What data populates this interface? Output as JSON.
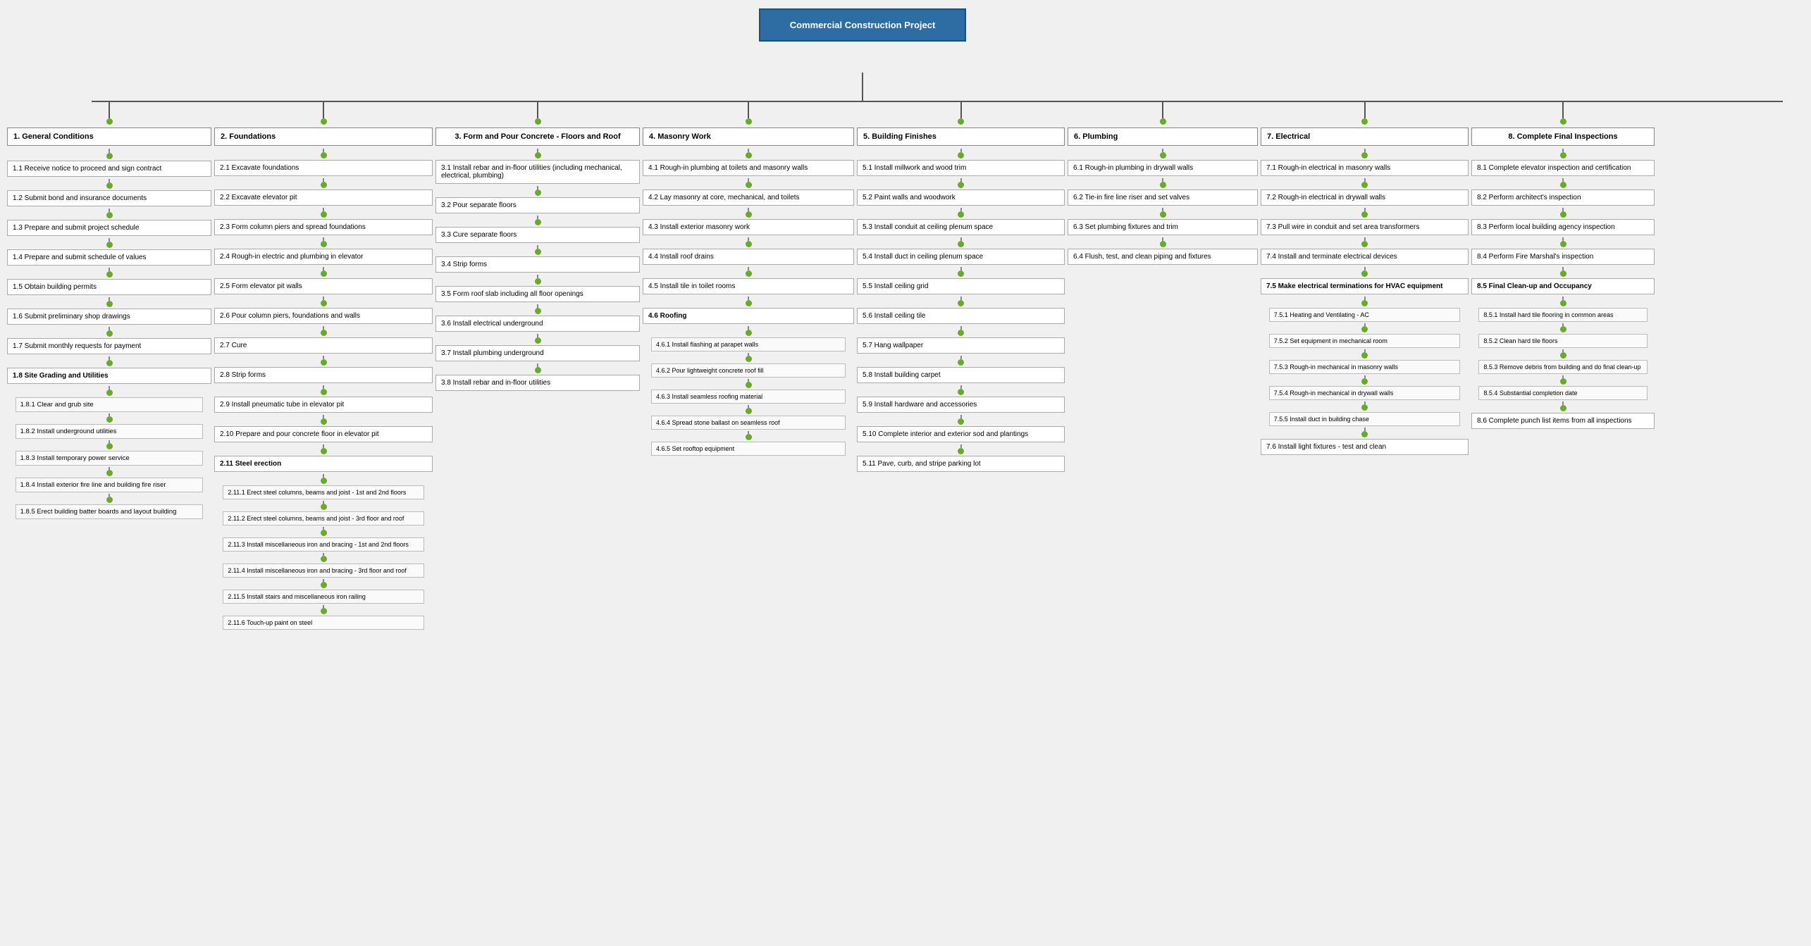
{
  "root": {
    "title": "Commercial Construction Project"
  },
  "columns": [
    {
      "id": "col1",
      "header": "1.  General Conditions",
      "tasks": [
        {
          "id": "1.1",
          "label": "1.1  Receive notice to proceed and sign contract"
        },
        {
          "id": "1.2",
          "label": "1.2  Submit bond and insurance documents"
        },
        {
          "id": "1.3",
          "label": "1.3  Prepare and submit project schedule"
        },
        {
          "id": "1.4",
          "label": "1.4  Prepare and submit schedule of values"
        },
        {
          "id": "1.5",
          "label": "1.5  Obtain building permits"
        },
        {
          "id": "1.6",
          "label": "1.6  Submit preliminary shop drawings"
        },
        {
          "id": "1.7",
          "label": "1.7  Submit monthly requests for payment"
        },
        {
          "id": "1.8",
          "label": "1.8  Site Grading and Utilities",
          "subtasks": [
            {
              "id": "1.8.1",
              "label": "1.8.1  Clear and grub site"
            },
            {
              "id": "1.8.2",
              "label": "1.8.2  Install underground utilities"
            },
            {
              "id": "1.8.3",
              "label": "1.8.3  Install temporary power service"
            },
            {
              "id": "1.8.4",
              "label": "1.8.4  Install exterior fire line and building fire riser"
            },
            {
              "id": "1.8.5",
              "label": "1.8.5  Erect building batter boards and layout building"
            }
          ]
        }
      ]
    },
    {
      "id": "col2",
      "header": "2.  Foundations",
      "tasks": [
        {
          "id": "2.1",
          "label": "2.1  Excavate foundations"
        },
        {
          "id": "2.2",
          "label": "2.2  Excavate elevator pit"
        },
        {
          "id": "2.3",
          "label": "2.3  Form column piers and spread foundations"
        },
        {
          "id": "2.4",
          "label": "2.4  Rough-in electric and plumbing in elevator"
        },
        {
          "id": "2.5",
          "label": "2.5  Form elevator pit walls"
        },
        {
          "id": "2.6",
          "label": "2.6  Pour column piers, foundations and walls"
        },
        {
          "id": "2.7",
          "label": "2.7  Cure"
        },
        {
          "id": "2.8",
          "label": "2.8  Strip forms"
        },
        {
          "id": "2.9",
          "label": "2.9  Install pneumatic tube in elevator pit"
        },
        {
          "id": "2.10",
          "label": "2.10  Prepare and pour concrete floor in elevator pit"
        },
        {
          "id": "2.11",
          "label": "2.11  Steel erection",
          "subtasks": [
            {
              "id": "2.11.1",
              "label": "2.11.1  Erect steel columns, beams and joist - 1st and 2nd floors"
            },
            {
              "id": "2.11.2",
              "label": "2.11.2  Erect steel columns, beams and joist - 3rd floor and roof"
            },
            {
              "id": "2.11.3",
              "label": "2.11.3  Install miscellaneous iron and bracing - 1st and 2nd floors"
            },
            {
              "id": "2.11.4",
              "label": "2.11.4  Install miscellaneous iron and bracing - 3rd floor and roof"
            },
            {
              "id": "2.11.5",
              "label": "2.11.5  Install stairs and miscellaneous iron railing"
            },
            {
              "id": "2.11.6",
              "label": "2.11.6  Touch-up paint on steel"
            }
          ]
        }
      ]
    },
    {
      "id": "col3",
      "header": "3.  Form and Pour Concrete - Floors and Roof",
      "tasks": [
        {
          "id": "3.1",
          "label": "3.1  Install rebar and in-floor utilities (including mechanical, electrical, plumbing)"
        },
        {
          "id": "3.2",
          "label": "3.2  Pour separate floors"
        },
        {
          "id": "3.3",
          "label": "3.3  Cure separate floors"
        },
        {
          "id": "3.4",
          "label": "3.4  Strip forms"
        },
        {
          "id": "3.5",
          "label": "3.5  Form roof slab including all floor openings"
        },
        {
          "id": "3.6",
          "label": "3.6  Install electrical underground"
        },
        {
          "id": "3.7",
          "label": "3.7  Install plumbing underground"
        },
        {
          "id": "3.8",
          "label": "3.8  Install rebar and in-floor utilities"
        }
      ]
    },
    {
      "id": "col4",
      "header": "4.  Masonry Work",
      "tasks": [
        {
          "id": "4.1",
          "label": "4.1  Rough-in plumbing at toilets and masonry walls"
        },
        {
          "id": "4.2",
          "label": "4.2  Lay masonry at core, mechanical, and toilets"
        },
        {
          "id": "4.3",
          "label": "4.3  Install exterior masonry work"
        },
        {
          "id": "4.4",
          "label": "4.4  Install roof drains"
        },
        {
          "id": "4.5",
          "label": "4.5  Install tile in toilet rooms"
        },
        {
          "id": "4.6",
          "label": "4.6  Roofing",
          "subtasks": [
            {
              "id": "4.6.1",
              "label": "4.6.1  Install flashing at parapet walls"
            },
            {
              "id": "4.6.2",
              "label": "4.6.2  Pour lightweight concrete roof fill"
            },
            {
              "id": "4.6.3",
              "label": "4.6.3  Install seamless roofing material"
            },
            {
              "id": "4.6.4",
              "label": "4.6.4  Spread stone ballast on seamless roof"
            },
            {
              "id": "4.6.5",
              "label": "4.6.5  Set rooftop equipment"
            }
          ]
        }
      ]
    },
    {
      "id": "col5",
      "header": "5.  Building Finishes",
      "tasks": [
        {
          "id": "5.1",
          "label": "5.1  Install millwork and wood trim"
        },
        {
          "id": "5.2",
          "label": "5.2  Paint walls and woodwork"
        },
        {
          "id": "5.3",
          "label": "5.3  Install conduit at ceiling plenum space"
        },
        {
          "id": "5.4",
          "label": "5.4  Install duct in ceiling plenum space"
        },
        {
          "id": "5.5",
          "label": "5.5  Install ceiling grid"
        },
        {
          "id": "5.6",
          "label": "5.6  Install ceiling tile"
        },
        {
          "id": "5.7",
          "label": "5.7  Hang wallpaper"
        },
        {
          "id": "5.8",
          "label": "5.8  Install building carpet"
        },
        {
          "id": "5.9",
          "label": "5.9  Install hardware and accessories"
        },
        {
          "id": "5.10",
          "label": "5.10  Complete interior and exterior sod and plantings"
        },
        {
          "id": "5.11",
          "label": "5.11  Pave, curb, and stripe parking lot"
        }
      ]
    },
    {
      "id": "col6",
      "header": "6.  Plumbing",
      "tasks": [
        {
          "id": "6.1",
          "label": "6.1  Rough-in plumbing in drywall walls"
        },
        {
          "id": "6.2",
          "label": "6.2  Tie-in fire line riser and set valves"
        },
        {
          "id": "6.3",
          "label": "6.3  Set plumbing fixtures and trim"
        },
        {
          "id": "6.4",
          "label": "6.4  Flush, test, and clean piping and fixtures"
        }
      ]
    },
    {
      "id": "col7",
      "header": "7.  Electrical",
      "tasks": [
        {
          "id": "7.1",
          "label": "7.1  Rough-in electrical in masonry walls"
        },
        {
          "id": "7.2",
          "label": "7.2  Rough-in electrical in drywall walls"
        },
        {
          "id": "7.3",
          "label": "7.3  Pull wire in conduit and set area transformers"
        },
        {
          "id": "7.4",
          "label": "7.4  Install and terminate electrical devices"
        },
        {
          "id": "7.5",
          "label": "7.5  Make electrical terminations for HVAC equipment",
          "subtasks": [
            {
              "id": "7.5.1",
              "label": "7.5.1  Heating and Ventilating - AC"
            },
            {
              "id": "7.5.2",
              "label": "7.5.2  Set equipment in mechanical room"
            },
            {
              "id": "7.5.3",
              "label": "7.5.3  Rough-in mechanical in masonry walls"
            },
            {
              "id": "7.5.4",
              "label": "7.5.4  Rough-in mechanical in drywall walls"
            },
            {
              "id": "7.5.5",
              "label": "7.5.5  Install duct in building chase"
            }
          ]
        },
        {
          "id": "7.6",
          "label": "7.6  Install light fixtures - test and clean"
        }
      ]
    },
    {
      "id": "col8",
      "header": "8.  Complete Final Inspections",
      "tasks": [
        {
          "id": "8.1",
          "label": "8.1  Complete elevator inspection and certification"
        },
        {
          "id": "8.2",
          "label": "8.2  Perform architect's inspection"
        },
        {
          "id": "8.3",
          "label": "8.3  Perform local building agency inspection"
        },
        {
          "id": "8.4",
          "label": "8.4  Perform Fire Marshal's inspection"
        },
        {
          "id": "8.5",
          "label": "8.5  Final Clean-up and Occupancy",
          "subtasks": [
            {
              "id": "8.5.1",
              "label": "8.5.1  Install hard tile flooring in common areas"
            },
            {
              "id": "8.5.2",
              "label": "8.5.2  Clean hard tile floors"
            },
            {
              "id": "8.5.3",
              "label": "8.5.3  Remove debris from building and do final clean-up"
            },
            {
              "id": "8.5.4",
              "label": "8.5.4  Substantial completion date"
            }
          ]
        },
        {
          "id": "8.6",
          "label": "8.6  Complete punch list items from all inspections"
        }
      ]
    }
  ]
}
